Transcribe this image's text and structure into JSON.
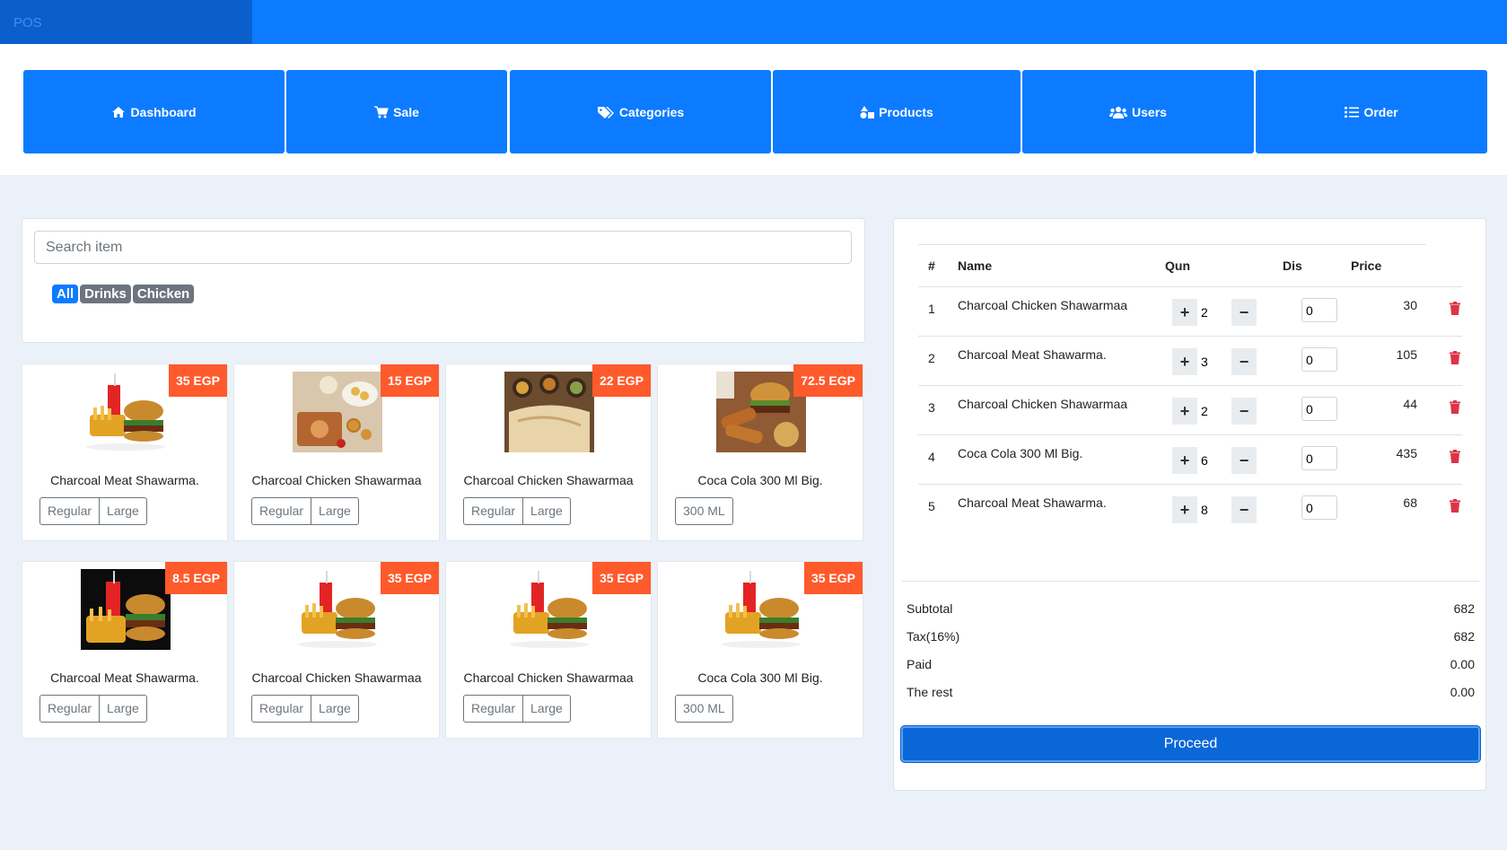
{
  "app": {
    "brand": "POS"
  },
  "nav": [
    {
      "label": "Dashboard",
      "icon": "home-icon"
    },
    {
      "label": "Sale",
      "icon": "cart-icon"
    },
    {
      "label": "Categories",
      "icon": "tags-icon"
    },
    {
      "label": "Products",
      "icon": "shapes-icon"
    },
    {
      "label": "Users",
      "icon": "users-icon"
    },
    {
      "label": "Order",
      "icon": "list-icon"
    }
  ],
  "search": {
    "placeholder": "Search item",
    "value": ""
  },
  "filters": [
    {
      "label": "All",
      "active": true
    },
    {
      "label": "Drinks",
      "active": false
    },
    {
      "label": "Chicken",
      "active": false
    }
  ],
  "products": [
    {
      "name": "Charcoal Meat Shawarma.",
      "price": "35 EGP",
      "image": "burger-combo",
      "variants": [
        "Regular",
        "Large"
      ]
    },
    {
      "name": "Charcoal Chicken Shawarmaa",
      "price": "15 EGP",
      "image": "appetizer-platter",
      "variants": [
        "Regular",
        "Large"
      ]
    },
    {
      "name": "Charcoal Chicken Shawarmaa",
      "price": "22 EGP",
      "image": "crepe-dish",
      "variants": [
        "Regular",
        "Large"
      ]
    },
    {
      "name": "Coca Cola 300 Ml Big.",
      "price": "72.5 EGP",
      "image": "fast-food-spread",
      "variants": [
        "300 ML"
      ]
    },
    {
      "name": "Charcoal Meat Shawarma.",
      "price": "8.5 EGP",
      "image": "burger-combo-dark",
      "variants": [
        "Regular",
        "Large"
      ]
    },
    {
      "name": "Charcoal Chicken Shawarmaa",
      "price": "35 EGP",
      "image": "burger-combo",
      "variants": [
        "Regular",
        "Large"
      ]
    },
    {
      "name": "Charcoal Chicken Shawarmaa",
      "price": "35 EGP",
      "image": "burger-combo",
      "variants": [
        "Regular",
        "Large"
      ]
    },
    {
      "name": "Coca Cola 300 Ml Big.",
      "price": "35 EGP",
      "image": "burger-combo",
      "variants": [
        "300 ML"
      ]
    }
  ],
  "cart": {
    "headers": {
      "num": "#",
      "name": "Name",
      "qty": "Qun",
      "dis": "Dis",
      "price": "Price"
    },
    "rows": [
      {
        "num": "1",
        "name": "Charcoal Chicken Shawarmaa",
        "qty": "2",
        "dis": "0",
        "price": "30"
      },
      {
        "num": "2",
        "name": "Charcoal Meat Shawarma.",
        "qty": "3",
        "dis": "0",
        "price": "105"
      },
      {
        "num": "3",
        "name": "Charcoal Chicken Shawarmaa",
        "qty": "2",
        "dis": "0",
        "price": "44"
      },
      {
        "num": "4",
        "name": "Coca Cola 300 Ml Big.",
        "qty": "6",
        "dis": "0",
        "price": "435"
      },
      {
        "num": "5",
        "name": "Charcoal Meat Shawarma.",
        "qty": "8",
        "dis": "0",
        "price": "68"
      }
    ],
    "summary": [
      {
        "label": "Subtotal",
        "value": "682"
      },
      {
        "label": "Tax(16%)",
        "value": "682"
      },
      {
        "label": "Paid",
        "value": "0.00"
      },
      {
        "label": "The rest",
        "value": "0.00"
      }
    ],
    "proceed_label": "Proceed"
  },
  "colors": {
    "primary": "#0d7bff",
    "badge": "#ff5a2c",
    "danger": "#dc3545",
    "muted": "#6c757d"
  }
}
